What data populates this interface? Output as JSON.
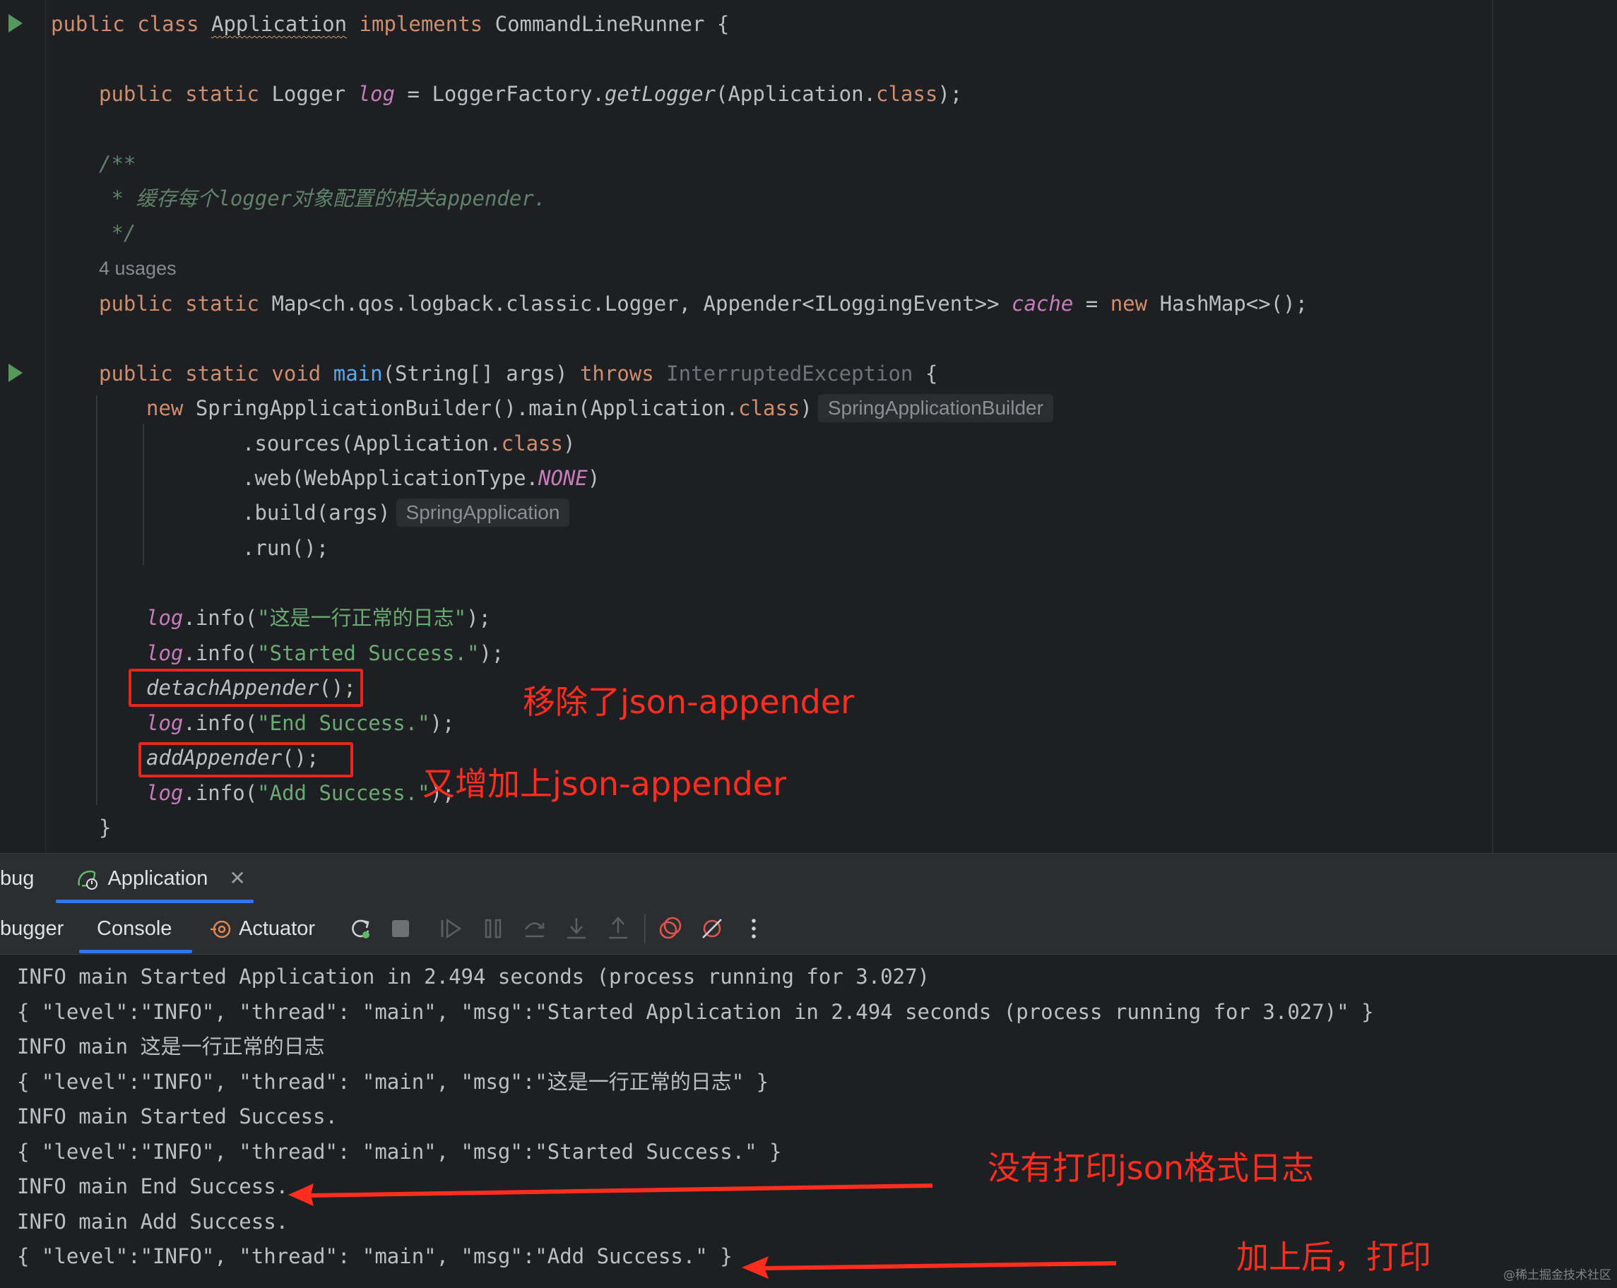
{
  "code": {
    "class_decl": {
      "mod1": "public",
      "mod2": "class",
      "name": "Application",
      "kw": "implements",
      "iface": "CommandLineRunner",
      "brace": " {"
    },
    "logger_decl": {
      "mods": "public static",
      "type": " Logger ",
      "field": "log",
      "eq": " = LoggerFactory.",
      "method": "getLogger",
      "args": "(Application.",
      "cls": "class",
      "end": ");"
    },
    "comment": {
      "open": "/**",
      "body": " * 缓存每个logger对象配置的相关appender.",
      "close": " */"
    },
    "usages": "4 usages",
    "cache_decl": {
      "mods": "public static",
      "type": " Map<ch.qos.logback.classic.Logger, Appender<ILoggingEvent>> ",
      "field": "cache",
      "eq": " = ",
      "new": "new",
      "rest": " HashMap<>();"
    },
    "main_decl": {
      "mods": "public static void",
      "name": "main",
      "params": "(String[] args) ",
      "throws": "throws",
      "exc": " InterruptedException",
      "brace": " {"
    },
    "builder": {
      "new": "new",
      "call": " SpringApplicationBuilder().main(Application.",
      "cls": "class",
      "end": ")",
      "hint": "SpringApplicationBuilder"
    },
    "sources": {
      "pre": ".sources(Application.",
      "cls": "class",
      "end": ")"
    },
    "web": {
      "pre": ".web(WebApplicationType.",
      "const": "NONE",
      "end": ")"
    },
    "build": {
      "pre": ".build(args)",
      "hint": "SpringApplication"
    },
    "run": ".run();",
    "log1": {
      "obj": "log",
      "call": ".info(",
      "str": "\"这是一行正常的日志\"",
      "end": ");"
    },
    "log2": {
      "obj": "log",
      "call": ".info(",
      "str": "\"Started Success.\"",
      "end": ");"
    },
    "detach": {
      "name": "detachAppender",
      "end": "();"
    },
    "log3": {
      "obj": "log",
      "call": ".info(",
      "str": "\"End Success.\"",
      "end": ");"
    },
    "add": {
      "name": "addAppender",
      "end": "();"
    },
    "log4": {
      "obj": "log",
      "call": ".info(",
      "str": "\"Add Success.\"",
      "end": ");"
    },
    "close_brace": "}"
  },
  "annotations": {
    "removed": "移除了json-appender",
    "readded": "又增加上json-appender",
    "no_json": "没有打印json格式日志",
    "after_add": "加上后，打印"
  },
  "tool_window": {
    "debug_label": "bug",
    "run_tab": "Application",
    "debugger_tab": "bugger",
    "console_tab": "Console",
    "actuator_tab": "Actuator",
    "icons": [
      "rerun-icon",
      "stop-icon",
      "resume-icon",
      "pause-icon",
      "step-over-icon",
      "step-into-icon",
      "step-out-icon",
      "view-breakpoints-icon",
      "mute-breakpoints-icon",
      "more-icon"
    ]
  },
  "console_lines": [
    "INFO main Started Application in 2.494 seconds (process running for 3.027)",
    "{ \"level\":\"INFO\", \"thread\": \"main\", \"msg\":\"Started Application in 2.494 seconds (process running for 3.027)\" }",
    "INFO main 这是一行正常的日志",
    "{ \"level\":\"INFO\", \"thread\": \"main\", \"msg\":\"这是一行正常的日志\" }",
    "INFO main Started Success.",
    "{ \"level\":\"INFO\", \"thread\": \"main\", \"msg\":\"Started Success.\" }",
    "INFO main End Success.",
    "INFO main Add Success.",
    "{ \"level\":\"INFO\", \"thread\": \"main\", \"msg\":\"Add Success.\" }"
  ],
  "colors": {
    "annotation_red": "#ff2d1e",
    "keyword": "#cf8e6d",
    "string": "#6aab73",
    "field": "#c77dbb",
    "method": "#56a8f5",
    "accent": "#3574f0"
  },
  "watermark": "@稀土掘金技术社区"
}
